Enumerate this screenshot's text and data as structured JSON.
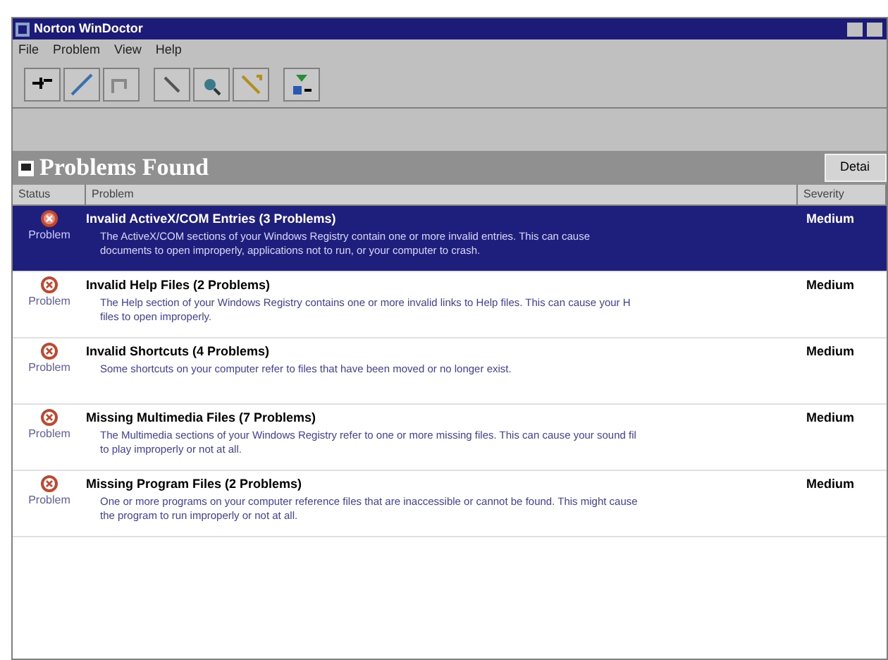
{
  "window": {
    "title": "Norton WinDoctor"
  },
  "menu": [
    "File",
    "Problem",
    "View",
    "Help"
  ],
  "panel": {
    "title": "Problems Found",
    "details_button": "Detai"
  },
  "columns": [
    "Status",
    "Problem",
    "Severity"
  ],
  "rows": [
    {
      "selected": true,
      "status": "Problem",
      "title": "Invalid ActiveX/COM Entries (3 Problems)",
      "severity": "Medium",
      "lines": [
        "The ActiveX/COM sections of your Windows Registry contain one or more invalid entries. This can cause",
        "documents to open improperly, applications not to run, or your computer to crash."
      ]
    },
    {
      "selected": false,
      "status": "Problem",
      "title": "Invalid Help Files (2 Problems)",
      "severity": "Medium",
      "lines": [
        "The Help section of your Windows Registry contains one or more invalid links to Help files. This can cause your H",
        "files to open improperly."
      ]
    },
    {
      "selected": false,
      "status": "Problem",
      "title": "Invalid Shortcuts (4 Problems)",
      "severity": "Medium",
      "lines": [
        "Some shortcuts on your computer refer to files that have been moved or no longer exist."
      ]
    },
    {
      "selected": false,
      "status": "Problem",
      "title": "Missing Multimedia Files (7 Problems)",
      "severity": "Medium",
      "lines": [
        "The Multimedia sections of your Windows Registry refer to one or more missing files. This can cause your sound fil",
        "to play improperly or not at all."
      ]
    },
    {
      "selected": false,
      "status": "Problem",
      "title": "Missing Program Files (2 Problems)",
      "severity": "Medium",
      "lines": [
        "One or more programs on your computer reference files that are inaccessible or cannot be found. This might cause",
        "the program to run improperly or not at all."
      ]
    }
  ]
}
